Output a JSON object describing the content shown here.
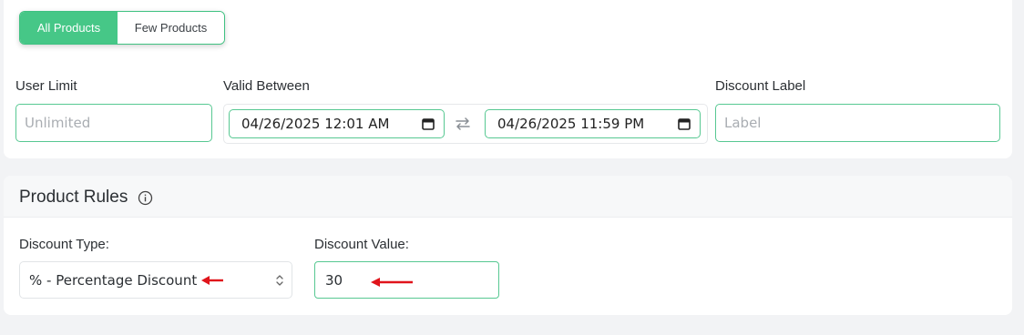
{
  "toggle": {
    "all_label": "All Products",
    "few_label": "Few Products",
    "selected": "All Products"
  },
  "fields": {
    "user_limit": {
      "label": "User Limit",
      "placeholder": "Unlimited",
      "value": ""
    },
    "valid_between": {
      "label": "Valid Between",
      "start": "04/26/2025 12:01 AM",
      "end": "04/26/2025 11:59 PM"
    },
    "discount_label": {
      "label": "Discount Label",
      "placeholder": "Label",
      "value": ""
    }
  },
  "product_rules": {
    "title": "Product Rules",
    "discount_type": {
      "label": "Discount Type:",
      "value": "% - Percentage Discount"
    },
    "discount_value": {
      "label": "Discount Value:",
      "value": "30"
    }
  },
  "icons": [
    "calendar-icon",
    "swap-icon",
    "info-icon",
    "select-arrows-icon",
    "annotation-arrow-icon"
  ],
  "colors": {
    "accent": "#46c787",
    "annotation": "#e0141b",
    "background": "#f2f3f5"
  }
}
